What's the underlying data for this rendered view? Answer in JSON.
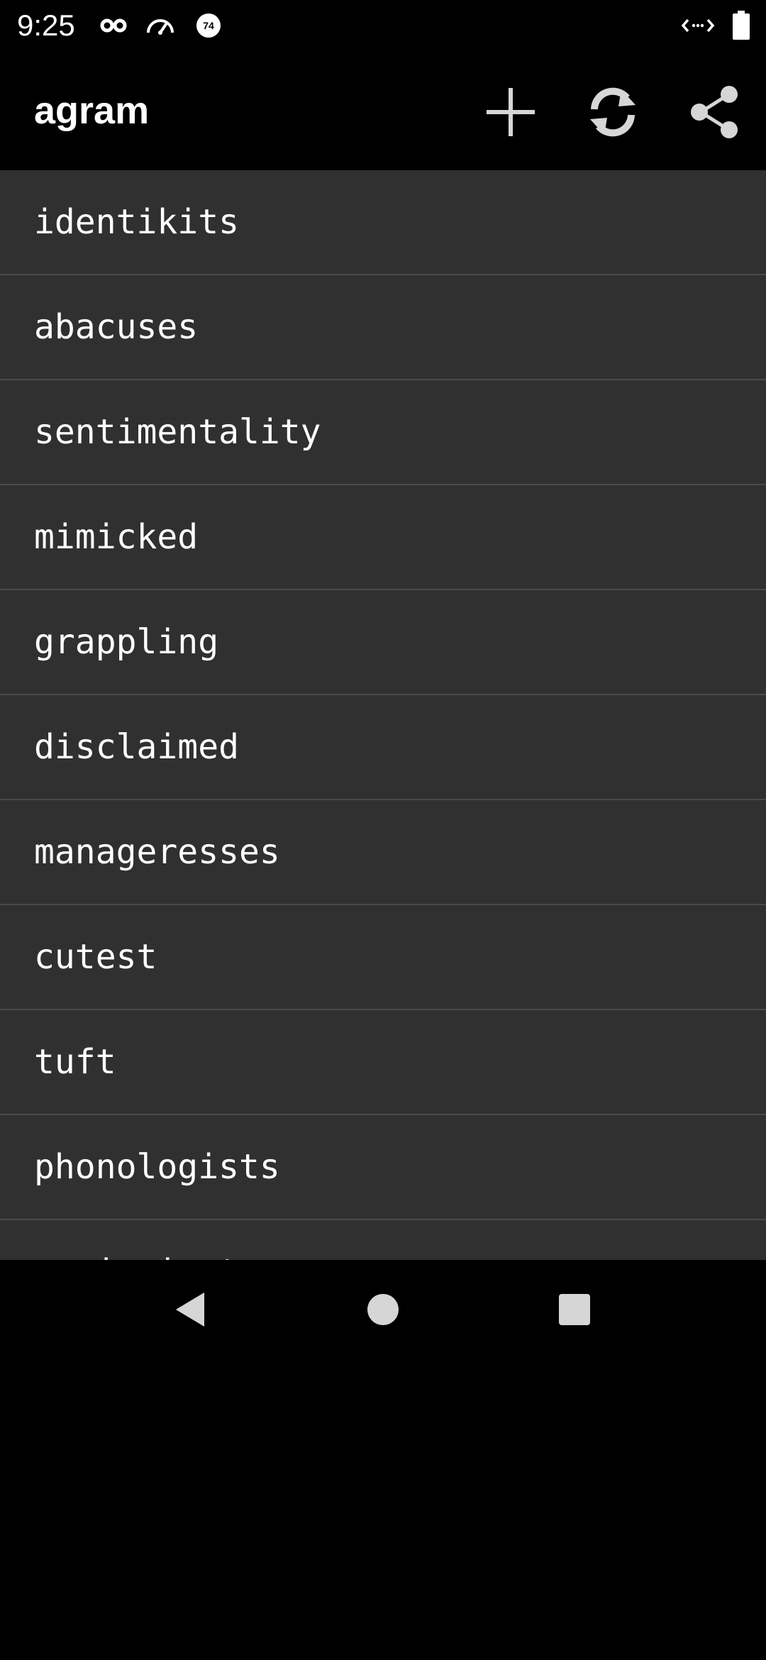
{
  "status_bar": {
    "time": "9:25",
    "icons": [
      "incognito-icon",
      "speedometer-icon",
      "badge-74-icon",
      "code-arrows-icon",
      "battery-icon"
    ],
    "badge_number": "74"
  },
  "app_bar": {
    "title": "agram",
    "actions": [
      "add-icon",
      "refresh-icon",
      "share-icon"
    ]
  },
  "list": {
    "items": [
      {
        "label": "identikits"
      },
      {
        "label": "abacuses"
      },
      {
        "label": "sentimentality"
      },
      {
        "label": "mimicked"
      },
      {
        "label": "grappling"
      },
      {
        "label": "disclaimed"
      },
      {
        "label": "manageresses"
      },
      {
        "label": "cutest"
      },
      {
        "label": "tuft"
      },
      {
        "label": "phonologists"
      },
      {
        "label": "omniscient"
      }
    ]
  },
  "nav_bar": {
    "buttons": [
      "back-icon",
      "home-icon",
      "recents-icon"
    ]
  },
  "colors": {
    "background": "#000000",
    "list_background": "#303030",
    "divider": "#4a4a4a",
    "text": "#ffffff",
    "icon": "#d6d6d6"
  }
}
